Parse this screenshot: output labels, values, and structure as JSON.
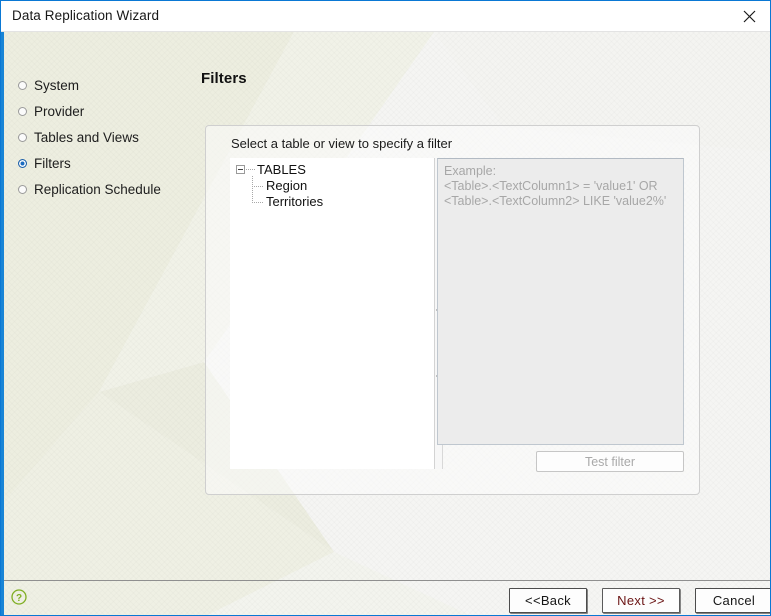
{
  "window": {
    "title": "Data Replication Wizard",
    "close_icon": "close-icon"
  },
  "sidebar": {
    "steps": [
      {
        "label": "System",
        "active": false
      },
      {
        "label": "Provider",
        "active": false
      },
      {
        "label": "Tables and Views",
        "active": false
      },
      {
        "label": "Filters",
        "active": true
      },
      {
        "label": "Replication Schedule",
        "active": false
      }
    ]
  },
  "main": {
    "page_title": "Filters",
    "panel_caption": "Select a table or view to specify a filter",
    "tree": {
      "root_label": "TABLES",
      "expander_state": "expanded",
      "children": [
        {
          "label": "Region"
        },
        {
          "label": "Territories"
        }
      ]
    },
    "splitter": {
      "collapse_icon_top": "triangle-left-icon",
      "collapse_icon_bottom": "triangle-left-icon"
    },
    "filter_editor": {
      "value": "",
      "placeholder": "Example:\n<Table>.<TextColumn1> = 'value1' OR\n<Table>.<TextColumn2> LIKE 'value2%'"
    },
    "test_filter_label": "Test filter"
  },
  "footer": {
    "help_icon": "help-circle-icon",
    "buttons": [
      {
        "label": "<<Back",
        "default": false
      },
      {
        "label": "Next >>",
        "default": true
      },
      {
        "label": "Cancel",
        "default": false
      }
    ]
  },
  "colors": {
    "accent_border": "#1884d6",
    "active_step": "#1c6cc0",
    "help_green": "#7fae22",
    "default_button_text": "#6b1414",
    "placeholder_text": "#a7a7a7"
  }
}
